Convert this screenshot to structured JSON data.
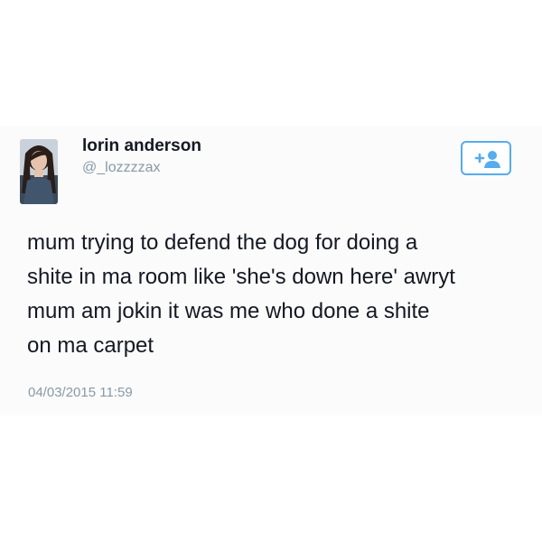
{
  "tweet": {
    "user": {
      "name": "lorin anderson",
      "handle": "@_lozzzzax",
      "avatar_icon": "profile-photo"
    },
    "follow_button": {
      "icon": "follow-user-icon",
      "accent_color": "#55acee"
    },
    "text_lines": [
      "mum trying to defend the dog for doing a",
      "shite in ma room like 'she's down here' awryt",
      "mum am jokin it was me who done a shite",
      "on ma carpet"
    ],
    "timestamp": "04/03/2015 11:59"
  }
}
